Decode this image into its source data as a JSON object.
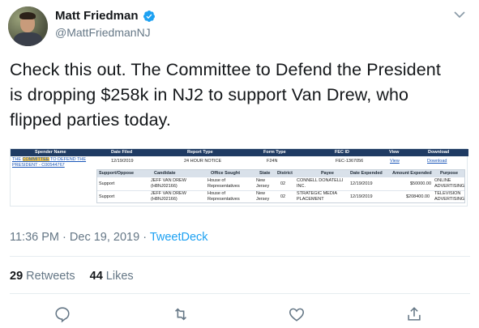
{
  "author": {
    "name": "Matt Friedman",
    "handle": "@MattFriedmanNJ",
    "verified": true
  },
  "tweet": {
    "text_line1": "Check this out. The Committee to Defend the President",
    "text_line2": "is dropping $258k in NJ2 to support Van Drew, who",
    "text_line3": "flipped parties today.",
    "time": "11:36 PM",
    "date": "Dec 19, 2019",
    "separator": "·",
    "dot": "·",
    "source": "TweetDeck"
  },
  "stats": {
    "retweets_count": "29",
    "retweets_label": "Retweets",
    "likes_count": "44",
    "likes_label": "Likes"
  },
  "embedded_image": {
    "headers": {
      "spender_name": "Spender Name",
      "date_filed": "Date Filed",
      "report_type": "Report Type",
      "form_type": "Form Type",
      "fec_id": "FEC ID",
      "view": "View",
      "download": "Download"
    },
    "row": {
      "spender_prefix": "THE ",
      "spender_highlight": "COMMITTEE",
      "spender_rest_1": " TO DEFEND THE",
      "spender_rest_2": "PRESIDENT - C00544767",
      "date_filed": "12/19/2019",
      "report_type": "24 HOUR NOTICE",
      "form_type": "F24N",
      "fec_id": "FEC-1367056",
      "view": "View",
      "download": "Download"
    },
    "inner_headers": {
      "support_oppose": "Support/Oppose",
      "candidate": "Candidate",
      "office_sought": "Office Sought",
      "state": "State",
      "district": "District",
      "payee": "Payee",
      "date_expended": "Date Expended",
      "amount_expended": "Amount Expended",
      "purpose": "Purpose"
    },
    "inner_rows": [
      {
        "support_oppose": "Support",
        "candidate_1": "JEFF VAN DREW",
        "candidate_2": "(H8NJ02166)",
        "office_1": "House of",
        "office_2": "Representatives",
        "state_1": "New",
        "state_2": "Jersey",
        "district": "02",
        "payee_1": "CONNELL DONATELLI",
        "payee_2": "INC.",
        "date_expended": "12/19/2019",
        "amount": "$50000.00",
        "purpose_1": "ONLINE",
        "purpose_2": "ADVERTISING"
      },
      {
        "support_oppose": "Support",
        "candidate_1": "JEFF VAN DREW",
        "candidate_2": "(H8NJ02166)",
        "office_1": "House of",
        "office_2": "Representatives",
        "state_1": "New",
        "state_2": "Jersey",
        "district": "02",
        "payee_1": "STRATEGIC MEDIA",
        "payee_2": "PLACEMENT",
        "date_expended": "12/19/2019",
        "amount": "$208400.00",
        "purpose_1": "TELEVISION",
        "purpose_2": "ADVERTISING"
      }
    ]
  },
  "actions": {
    "reply_icon": "reply-icon",
    "retweet_icon": "retweet-icon",
    "like_icon": "like-icon",
    "share_icon": "share-icon"
  },
  "colors": {
    "link_blue": "#1da1f2",
    "muted_gray": "#657786",
    "text_dark": "#14171a",
    "fec_header": "#1f3b63"
  }
}
